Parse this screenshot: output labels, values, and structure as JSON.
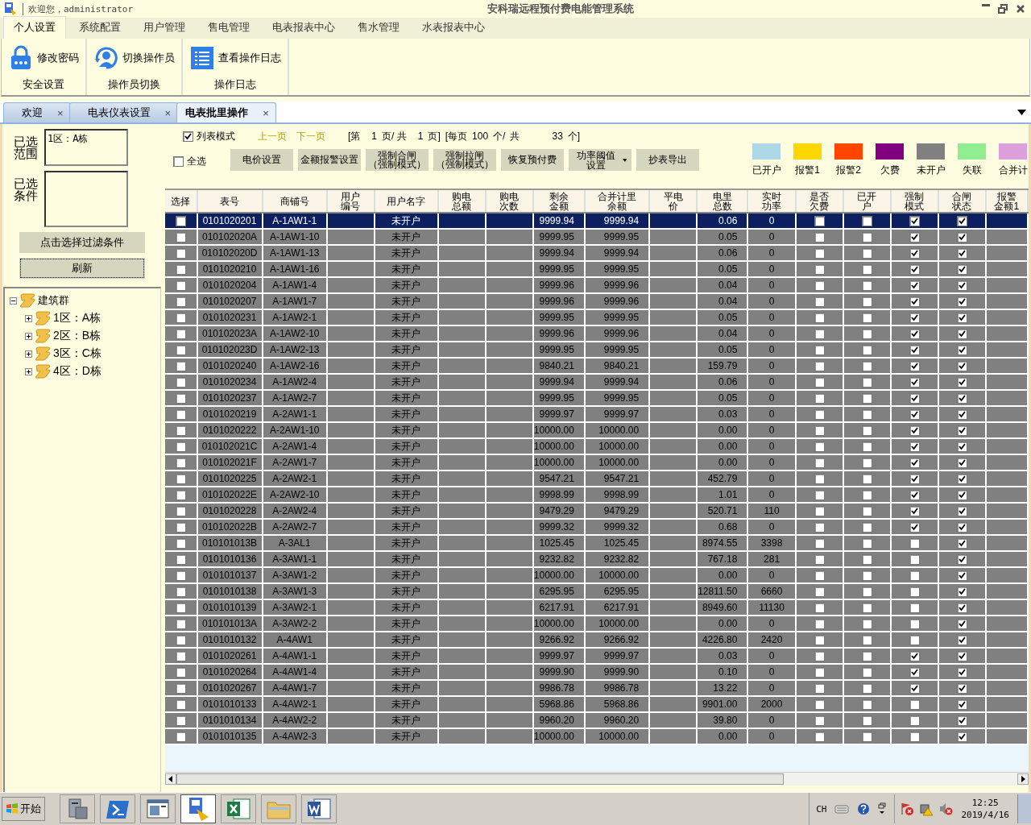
{
  "window": {
    "greeting": "欢迎您，administrator",
    "title": "安科瑞远程预付费电能管理系统"
  },
  "menu_tabs": [
    {
      "label": "个人设置",
      "selected": true
    },
    {
      "label": "系统配置",
      "selected": false
    },
    {
      "label": "用户管理",
      "selected": false
    },
    {
      "label": "售电管理",
      "selected": false
    },
    {
      "label": "电表报表中心",
      "selected": false
    },
    {
      "label": "售水管理",
      "selected": false
    },
    {
      "label": "水表报表中心",
      "selected": false
    }
  ],
  "ribbon_groups": [
    {
      "button": "修改密码",
      "caption": "安全设置"
    },
    {
      "button": "切换操作员",
      "caption": "操作员切换"
    },
    {
      "button": "查看操作日志",
      "caption": "操作日志"
    }
  ],
  "doc_tabs": [
    {
      "label": "欢迎",
      "close": "×",
      "selected": false
    },
    {
      "label": "电表仪表设置",
      "close": "×",
      "selected": false
    },
    {
      "label": "电表批里操作",
      "close": "×",
      "selected": true
    }
  ],
  "filter": {
    "range_label": "已选范围",
    "range_value": "1区：A栋",
    "condition_label": "已选条件",
    "choose_button": "点击选择过滤条件",
    "refresh_button": "刷新"
  },
  "tree": [
    {
      "label": "建筑群",
      "expanded": true,
      "children": [
        {
          "label": "1区：A栋",
          "expanded": false
        },
        {
          "label": "2区：B栋",
          "expanded": false
        },
        {
          "label": "3区：C栋",
          "expanded": false
        },
        {
          "label": "4区：D栋",
          "expanded": false
        }
      ]
    }
  ],
  "list_mode": {
    "label": "列表模式",
    "checked": true
  },
  "pager": {
    "prev": "上一页",
    "next": "下一页",
    "page_open": "[第",
    "page": "1",
    "page_mid": "页/ 共",
    "pages": "1",
    "page_close": "页]",
    "per_open": "[每页",
    "per_page": "100",
    "per_mid": "个/",
    "total_label": "共",
    "total": "33",
    "per_close": "个]"
  },
  "select_all": {
    "label": "全选",
    "checked": false
  },
  "actions": [
    {
      "label": "电价设置",
      "dropdown": false
    },
    {
      "label": "金额报警设置",
      "dropdown": false
    },
    {
      "label": "强制合闸（强制模式）",
      "dropdown": false
    },
    {
      "label": "强制拉闸（强制模式）",
      "dropdown": false
    },
    {
      "label": "恢复预付费",
      "dropdown": false
    },
    {
      "label": "功率阈值设置",
      "dropdown": true
    },
    {
      "label": "抄表导出",
      "dropdown": false
    }
  ],
  "legend": [
    {
      "label": "已开户",
      "color": "#add8e6"
    },
    {
      "label": "报警1",
      "color": "#ffd700"
    },
    {
      "label": "报警2",
      "color": "#ff4500"
    },
    {
      "label": "欠费",
      "color": "#800080"
    },
    {
      "label": "未开户",
      "color": "#808080"
    },
    {
      "label": "失联",
      "color": "#90ee90"
    },
    {
      "label": "合并计",
      "color": "#dda0dd"
    }
  ],
  "table": {
    "columns": [
      {
        "label": "选择",
        "kind": "check"
      },
      {
        "label": "表号",
        "kind": "text"
      },
      {
        "label": "商铺号",
        "kind": "text"
      },
      {
        "label": "用户编号",
        "kind": "text"
      },
      {
        "label": "用户名字",
        "kind": "text"
      },
      {
        "label": "购电总额",
        "kind": "text"
      },
      {
        "label": "购电次数",
        "kind": "text"
      },
      {
        "label": "剩余金额",
        "kind": "num"
      },
      {
        "label": "合并计里余额",
        "kind": "num"
      },
      {
        "label": "平电价",
        "kind": "text"
      },
      {
        "label": "电里总数",
        "kind": "num"
      },
      {
        "label": "实时功率",
        "kind": "text"
      },
      {
        "label": "是否欠费",
        "kind": "check"
      },
      {
        "label": "已开户",
        "kind": "check"
      },
      {
        "label": "强制模式",
        "kind": "check"
      },
      {
        "label": "合闸状态",
        "kind": "check"
      },
      {
        "label": "报警金额1",
        "kind": "text"
      }
    ],
    "rows": [
      {
        "selected": true,
        "checked": false,
        "meter_no": "0101020201",
        "shop_no": "A-1AW1-1",
        "user_name": "未开户",
        "remaining": "9999.94",
        "merged_balance": "9999.94",
        "energy_total": "0.06",
        "power": "0",
        "arrears": false,
        "opened": false,
        "forced": true,
        "closed": true
      },
      {
        "selected": false,
        "checked": false,
        "meter_no": "010102020A",
        "shop_no": "A-1AW1-10",
        "user_name": "未开户",
        "remaining": "9999.95",
        "merged_balance": "9999.95",
        "energy_total": "0.05",
        "power": "0",
        "arrears": false,
        "opened": false,
        "forced": true,
        "closed": true
      },
      {
        "selected": false,
        "checked": false,
        "meter_no": "010102020D",
        "shop_no": "A-1AW1-13",
        "user_name": "未开户",
        "remaining": "9999.94",
        "merged_balance": "9999.94",
        "energy_total": "0.06",
        "power": "0",
        "arrears": false,
        "opened": false,
        "forced": true,
        "closed": true
      },
      {
        "selected": false,
        "checked": false,
        "meter_no": "0101020210",
        "shop_no": "A-1AW1-16",
        "user_name": "未开户",
        "remaining": "9999.95",
        "merged_balance": "9999.95",
        "energy_total": "0.05",
        "power": "0",
        "arrears": false,
        "opened": false,
        "forced": true,
        "closed": true
      },
      {
        "selected": false,
        "checked": false,
        "meter_no": "0101020204",
        "shop_no": "A-1AW1-4",
        "user_name": "未开户",
        "remaining": "9999.96",
        "merged_balance": "9999.96",
        "energy_total": "0.04",
        "power": "0",
        "arrears": false,
        "opened": false,
        "forced": true,
        "closed": true
      },
      {
        "selected": false,
        "checked": false,
        "meter_no": "0101020207",
        "shop_no": "A-1AW1-7",
        "user_name": "未开户",
        "remaining": "9999.96",
        "merged_balance": "9999.96",
        "energy_total": "0.04",
        "power": "0",
        "arrears": false,
        "opened": false,
        "forced": true,
        "closed": true
      },
      {
        "selected": false,
        "checked": false,
        "meter_no": "0101020231",
        "shop_no": "A-1AW2-1",
        "user_name": "未开户",
        "remaining": "9999.95",
        "merged_balance": "9999.95",
        "energy_total": "0.05",
        "power": "0",
        "arrears": false,
        "opened": false,
        "forced": true,
        "closed": true
      },
      {
        "selected": false,
        "checked": false,
        "meter_no": "010102023A",
        "shop_no": "A-1AW2-10",
        "user_name": "未开户",
        "remaining": "9999.96",
        "merged_balance": "9999.96",
        "energy_total": "0.04",
        "power": "0",
        "arrears": false,
        "opened": false,
        "forced": true,
        "closed": true
      },
      {
        "selected": false,
        "checked": false,
        "meter_no": "010102023D",
        "shop_no": "A-1AW2-13",
        "user_name": "未开户",
        "remaining": "9999.95",
        "merged_balance": "9999.95",
        "energy_total": "0.05",
        "power": "0",
        "arrears": false,
        "opened": false,
        "forced": true,
        "closed": true
      },
      {
        "selected": false,
        "checked": false,
        "meter_no": "0101020240",
        "shop_no": "A-1AW2-16",
        "user_name": "未开户",
        "remaining": "9840.21",
        "merged_balance": "9840.21",
        "energy_total": "159.79",
        "power": "0",
        "arrears": false,
        "opened": false,
        "forced": true,
        "closed": true
      },
      {
        "selected": false,
        "checked": false,
        "meter_no": "0101020234",
        "shop_no": "A-1AW2-4",
        "user_name": "未开户",
        "remaining": "9999.94",
        "merged_balance": "9999.94",
        "energy_total": "0.06",
        "power": "0",
        "arrears": false,
        "opened": false,
        "forced": true,
        "closed": true
      },
      {
        "selected": false,
        "checked": false,
        "meter_no": "0101020237",
        "shop_no": "A-1AW2-7",
        "user_name": "未开户",
        "remaining": "9999.95",
        "merged_balance": "9999.95",
        "energy_total": "0.05",
        "power": "0",
        "arrears": false,
        "opened": false,
        "forced": true,
        "closed": true
      },
      {
        "selected": false,
        "checked": false,
        "meter_no": "0101020219",
        "shop_no": "A-2AW1-1",
        "user_name": "未开户",
        "remaining": "9999.97",
        "merged_balance": "9999.97",
        "energy_total": "0.03",
        "power": "0",
        "arrears": false,
        "opened": false,
        "forced": true,
        "closed": true
      },
      {
        "selected": false,
        "checked": false,
        "meter_no": "0101020222",
        "shop_no": "A-2AW1-10",
        "user_name": "未开户",
        "remaining": "10000.00",
        "merged_balance": "10000.00",
        "energy_total": "0.00",
        "power": "0",
        "arrears": false,
        "opened": false,
        "forced": true,
        "closed": true
      },
      {
        "selected": false,
        "checked": false,
        "meter_no": "010102021C",
        "shop_no": "A-2AW1-4",
        "user_name": "未开户",
        "remaining": "10000.00",
        "merged_balance": "10000.00",
        "energy_total": "0.00",
        "power": "0",
        "arrears": false,
        "opened": false,
        "forced": true,
        "closed": true
      },
      {
        "selected": false,
        "checked": false,
        "meter_no": "010102021F",
        "shop_no": "A-2AW1-7",
        "user_name": "未开户",
        "remaining": "10000.00",
        "merged_balance": "10000.00",
        "energy_total": "0.00",
        "power": "0",
        "arrears": false,
        "opened": false,
        "forced": true,
        "closed": true
      },
      {
        "selected": false,
        "checked": false,
        "meter_no": "0101020225",
        "shop_no": "A-2AW2-1",
        "user_name": "未开户",
        "remaining": "9547.21",
        "merged_balance": "9547.21",
        "energy_total": "452.79",
        "power": "0",
        "arrears": false,
        "opened": false,
        "forced": true,
        "closed": true
      },
      {
        "selected": false,
        "checked": false,
        "meter_no": "010102022E",
        "shop_no": "A-2AW2-10",
        "user_name": "未开户",
        "remaining": "9998.99",
        "merged_balance": "9998.99",
        "energy_total": "1.01",
        "power": "0",
        "arrears": false,
        "opened": false,
        "forced": true,
        "closed": true
      },
      {
        "selected": false,
        "checked": false,
        "meter_no": "0101020228",
        "shop_no": "A-2AW2-4",
        "user_name": "未开户",
        "remaining": "9479.29",
        "merged_balance": "9479.29",
        "energy_total": "520.71",
        "power": "110",
        "arrears": false,
        "opened": false,
        "forced": true,
        "closed": true
      },
      {
        "selected": false,
        "checked": false,
        "meter_no": "010102022B",
        "shop_no": "A-2AW2-7",
        "user_name": "未开户",
        "remaining": "9999.32",
        "merged_balance": "9999.32",
        "energy_total": "0.68",
        "power": "0",
        "arrears": false,
        "opened": false,
        "forced": true,
        "closed": true
      },
      {
        "selected": false,
        "checked": false,
        "meter_no": "010101013B",
        "shop_no": "A-3AL1",
        "user_name": "未开户",
        "remaining": "1025.45",
        "merged_balance": "1025.45",
        "energy_total": "8974.55",
        "power": "3398",
        "arrears": false,
        "opened": false,
        "forced": false,
        "closed": true
      },
      {
        "selected": false,
        "checked": false,
        "meter_no": "0101010136",
        "shop_no": "A-3AW1-1",
        "user_name": "未开户",
        "remaining": "9232.82",
        "merged_balance": "9232.82",
        "energy_total": "767.18",
        "power": "281",
        "arrears": false,
        "opened": false,
        "forced": false,
        "closed": true
      },
      {
        "selected": false,
        "checked": false,
        "meter_no": "0101010137",
        "shop_no": "A-3AW1-2",
        "user_name": "未开户",
        "remaining": "10000.00",
        "merged_balance": "10000.00",
        "energy_total": "0.00",
        "power": "0",
        "arrears": false,
        "opened": false,
        "forced": false,
        "closed": true
      },
      {
        "selected": false,
        "checked": false,
        "meter_no": "0101010138",
        "shop_no": "A-3AW1-3",
        "user_name": "未开户",
        "remaining": "6295.95",
        "merged_balance": "6295.95",
        "energy_total": "12811.50",
        "power": "6660",
        "arrears": false,
        "opened": false,
        "forced": false,
        "closed": true
      },
      {
        "selected": false,
        "checked": false,
        "meter_no": "0101010139",
        "shop_no": "A-3AW2-1",
        "user_name": "未开户",
        "remaining": "6217.91",
        "merged_balance": "6217.91",
        "energy_total": "8949.60",
        "power": "11130",
        "arrears": false,
        "opened": false,
        "forced": false,
        "closed": true
      },
      {
        "selected": false,
        "checked": false,
        "meter_no": "010101013A",
        "shop_no": "A-3AW2-2",
        "user_name": "未开户",
        "remaining": "10000.00",
        "merged_balance": "10000.00",
        "energy_total": "0.00",
        "power": "0",
        "arrears": false,
        "opened": false,
        "forced": false,
        "closed": true
      },
      {
        "selected": false,
        "checked": false,
        "meter_no": "0101010132",
        "shop_no": "A-4AW1",
        "user_name": "未开户",
        "remaining": "9266.92",
        "merged_balance": "9266.92",
        "energy_total": "4226.80",
        "power": "2420",
        "arrears": false,
        "opened": false,
        "forced": false,
        "closed": true
      },
      {
        "selected": false,
        "checked": false,
        "meter_no": "0101020261",
        "shop_no": "A-4AW1-1",
        "user_name": "未开户",
        "remaining": "9999.97",
        "merged_balance": "9999.97",
        "energy_total": "0.03",
        "power": "0",
        "arrears": false,
        "opened": false,
        "forced": true,
        "closed": true
      },
      {
        "selected": false,
        "checked": false,
        "meter_no": "0101020264",
        "shop_no": "A-4AW1-4",
        "user_name": "未开户",
        "remaining": "9999.90",
        "merged_balance": "9999.90",
        "energy_total": "0.10",
        "power": "0",
        "arrears": false,
        "opened": false,
        "forced": true,
        "closed": true
      },
      {
        "selected": false,
        "checked": false,
        "meter_no": "0101020267",
        "shop_no": "A-4AW1-7",
        "user_name": "未开户",
        "remaining": "9986.78",
        "merged_balance": "9986.78",
        "energy_total": "13.22",
        "power": "0",
        "arrears": false,
        "opened": false,
        "forced": true,
        "closed": true
      },
      {
        "selected": false,
        "checked": false,
        "meter_no": "0101010133",
        "shop_no": "A-4AW2-1",
        "user_name": "未开户",
        "remaining": "5968.86",
        "merged_balance": "5968.86",
        "energy_total": "9901.00",
        "power": "2000",
        "arrears": false,
        "opened": false,
        "forced": false,
        "closed": true
      },
      {
        "selected": false,
        "checked": false,
        "meter_no": "0101010134",
        "shop_no": "A-4AW2-2",
        "user_name": "未开户",
        "remaining": "9960.20",
        "merged_balance": "9960.20",
        "energy_total": "39.80",
        "power": "0",
        "arrears": false,
        "opened": false,
        "forced": false,
        "closed": true
      },
      {
        "selected": false,
        "checked": false,
        "meter_no": "0101010135",
        "shop_no": "A-4AW2-3",
        "user_name": "未开户",
        "remaining": "10000.00",
        "merged_balance": "10000.00",
        "energy_total": "0.00",
        "power": "0",
        "arrears": false,
        "opened": false,
        "forced": false,
        "closed": true
      }
    ]
  },
  "taskbar": {
    "start": "开始",
    "apps": [
      {
        "active": false
      },
      {
        "active": false
      },
      {
        "active": false
      },
      {
        "active": true
      },
      {
        "active": false
      },
      {
        "active": false
      },
      {
        "active": false
      }
    ],
    "language": "CH",
    "time": "12:25",
    "date": "2019/4/16"
  }
}
